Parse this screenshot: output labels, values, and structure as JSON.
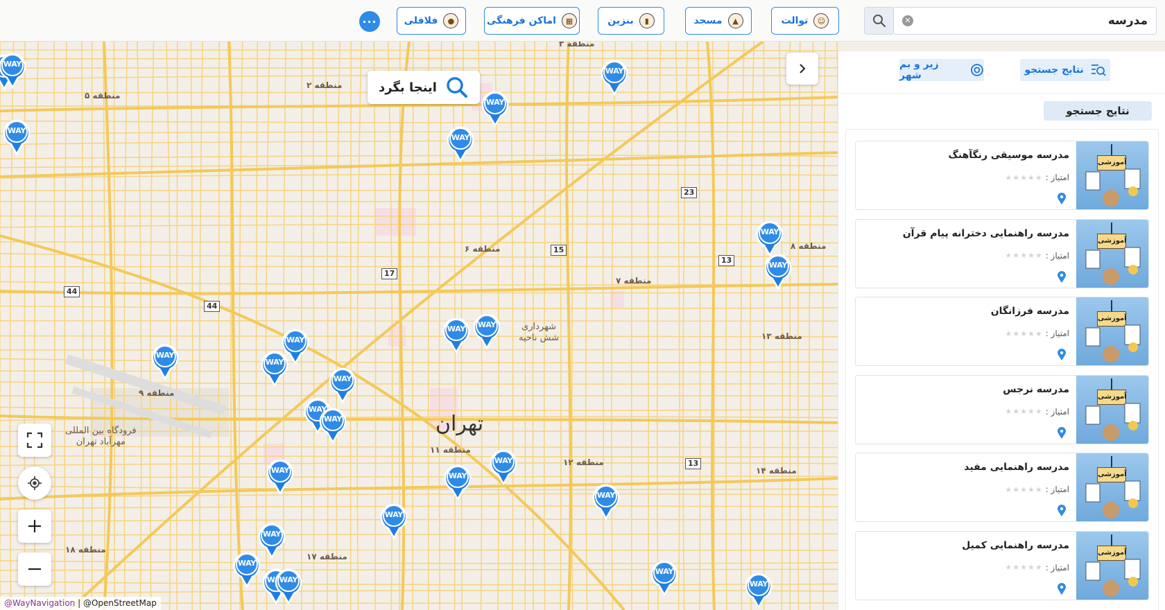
{
  "topbar": {
    "search_value": "مدرسه",
    "chips": [
      {
        "label": "توالت",
        "icon": "toilet-icon"
      },
      {
        "label": "مسجد",
        "icon": "mosque-icon"
      },
      {
        "label": "بنزین",
        "icon": "gas-station-icon"
      },
      {
        "label": "اماکن فرهنگی",
        "icon": "cultural-place-icon"
      },
      {
        "label": "فلافلی",
        "icon": "falafel-icon"
      }
    ],
    "more_label": "···"
  },
  "map": {
    "search_here_label": "اینجا بگرد",
    "city_label": "تهران",
    "city_hall_label": "شهرداری\nشش ناحیه",
    "airport_label": "فرودگاه بین المللی\nمهرآباد تهران",
    "district_labels": [
      "منطقه ۳",
      "منطقه ۲",
      "منطقه ۵",
      "منطقه ۶",
      "منطقه ۷",
      "منطقه ۸",
      "منطقه ۱۳",
      "منطقه ۹",
      "منطقه ۱۱",
      "منطقه ۱۲",
      "منطقه ۱۴",
      "منطقه ۱۸",
      "منطقه ۱۷"
    ],
    "route_shields": [
      "23",
      "15",
      "17",
      "13",
      "44",
      "44",
      "13"
    ],
    "pin_label": "WAY",
    "pin_color": "#2f8be6",
    "attribution": {
      "way": "@WayNavigation",
      "osm": "@OpenStreetMap"
    }
  },
  "panel": {
    "tab_results": "نتایج جستجو",
    "tab_explore": "زیر و بم شهر",
    "section_title": "نتایج جستجو",
    "rating_label": "امتیاز :",
    "thumb_label": "آموزشی",
    "results": [
      {
        "title": "مدرسه موسیقی رنگآهنگ"
      },
      {
        "title": "مدرسه راهنمایی دخترانه پیام قرآن"
      },
      {
        "title": "مدرسه فرزانگان"
      },
      {
        "title": "مدرسه نرجس"
      },
      {
        "title": "مدرسه راهنمایی مفید"
      },
      {
        "title": "مدرسه راهنمایی کمیل"
      }
    ]
  }
}
